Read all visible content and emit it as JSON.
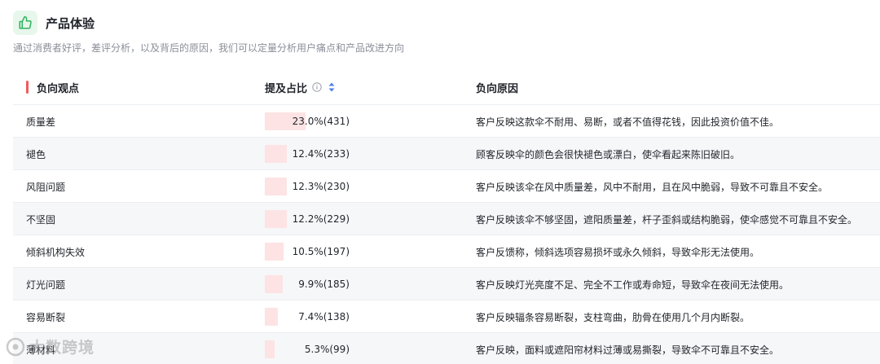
{
  "header": {
    "title": "产品体验",
    "subtitle": "通过消费者好评，差评分析，以及背后的原因，我们可以定量分析用户痛点和产品改进方向",
    "icon": "thumbs-up-icon",
    "accent": "#2fb35c"
  },
  "table": {
    "columns": {
      "view": "负向观点",
      "ratio": "提及占比",
      "reason": "负向原因"
    },
    "rows": [
      {
        "view": "质量差",
        "share": 23.0,
        "pct": "23.0%(431)",
        "reason": "客户反映这款伞不耐用、易断，或者不值得花钱，因此投资价值不佳。"
      },
      {
        "view": "褪色",
        "share": 12.4,
        "pct": "12.4%(233)",
        "reason": "顾客反映伞的颜色会很快褪色或漂白，使伞看起来陈旧破旧。"
      },
      {
        "view": "风阻问题",
        "share": 12.3,
        "pct": "12.3%(230)",
        "reason": "客户反映该伞在风中质量差，风中不耐用，且在风中脆弱，导致不可靠且不安全。"
      },
      {
        "view": "不坚固",
        "share": 12.2,
        "pct": "12.2%(229)",
        "reason": "客户反映该伞不够坚固，遮阳质量差，杆子歪斜或结构脆弱，使伞感觉不可靠且不安全。"
      },
      {
        "view": "倾斜机构失效",
        "share": 10.5,
        "pct": "10.5%(197)",
        "reason": "客户反馈称，倾斜选项容易损坏或永久倾斜，导致伞形无法使用。"
      },
      {
        "view": "灯光问题",
        "share": 9.9,
        "pct": "9.9%(185)",
        "reason": "客户反映灯光亮度不足、完全不工作或寿命短，导致伞在夜间无法使用。"
      },
      {
        "view": "容易断裂",
        "share": 7.4,
        "pct": "7.4%(138)",
        "reason": "客户反映辐条容易断裂，支柱弯曲，肋骨在使用几个月内断裂。"
      },
      {
        "view": "薄材料",
        "share": 5.3,
        "pct": "5.3%(99)",
        "reason": "客户反映，面料或遮阳帘材料过薄或易撕裂，导致伞不可靠且不安全。"
      }
    ],
    "bar_color": "#fde3e3",
    "marker_color": "#f05b5b"
  },
  "watermark": {
    "text": "大数跨境"
  }
}
